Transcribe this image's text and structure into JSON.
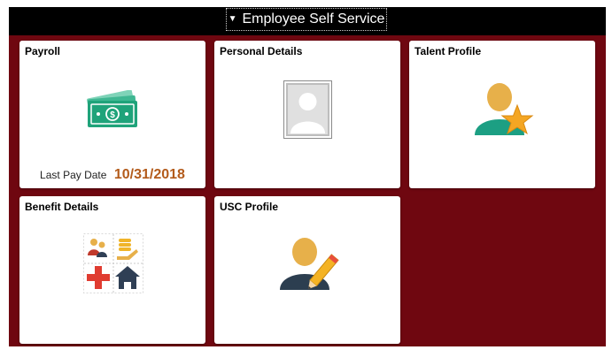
{
  "header": {
    "title": "Employee Self Service"
  },
  "tiles": {
    "payroll": {
      "title": "Payroll",
      "last_pay_label": "Last Pay Date",
      "last_pay_value": "10/31/2018",
      "icon": "cash-icon"
    },
    "personal_details": {
      "title": "Personal Details",
      "icon": "portrait-icon"
    },
    "talent_profile": {
      "title": "Talent Profile",
      "icon": "person-star-icon"
    },
    "benefit_details": {
      "title": "Benefit Details",
      "icon": "benefits-grid-icon"
    },
    "usc_profile": {
      "title": "USC Profile",
      "icon": "person-pencil-icon"
    }
  },
  "colors": {
    "background": "#6f0710",
    "header_bar": "#000000",
    "accent_date": "#b35b1b",
    "cash_green": "#1fa37a"
  }
}
